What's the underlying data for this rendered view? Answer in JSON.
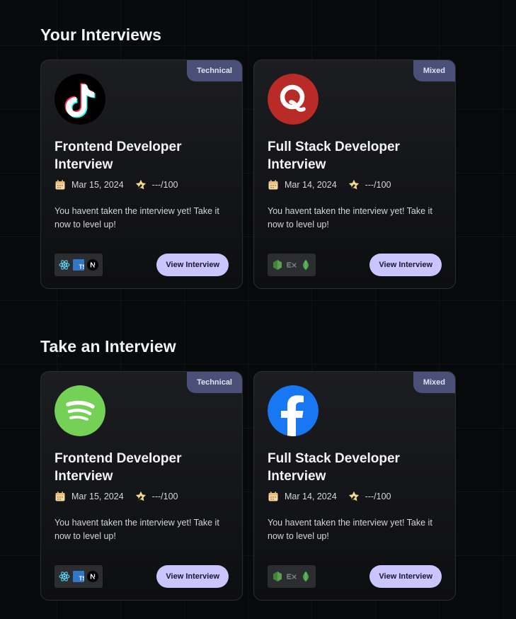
{
  "sections": [
    {
      "title": "Your Interviews",
      "cards": [
        {
          "badge": "Technical",
          "logo": "tiktok-logo",
          "title": "Frontend Developer Interview",
          "date": "Mar 15, 2024",
          "score": "---/100",
          "description": "You havent taken the interview yet! Take it now to level up!",
          "tech": [
            "react-icon",
            "typescript-icon",
            "nextjs-icon"
          ],
          "button": "View Interview"
        },
        {
          "badge": "Mixed",
          "logo": "quora-logo",
          "title": "Full Stack Developer Interview",
          "date": "Mar 14, 2024",
          "score": "---/100",
          "description": "You havent taken the interview yet! Take it now to level up!",
          "tech": [
            "nodejs-icon",
            "express-icon",
            "mongodb-icon"
          ],
          "button": "View Interview"
        }
      ]
    },
    {
      "title": "Take an Interview",
      "cards": [
        {
          "badge": "Technical",
          "logo": "spotify-logo",
          "title": "Frontend Developer Interview",
          "date": "Mar 15, 2024",
          "score": "---/100",
          "description": "You havent taken the interview yet! Take it now to level up!",
          "tech": [
            "react-icon",
            "typescript-icon",
            "nextjs-icon"
          ],
          "button": "View Interview"
        },
        {
          "badge": "Mixed",
          "logo": "facebook-logo",
          "title": "Full Stack Developer Interview",
          "date": "Mar 14, 2024",
          "score": "---/100",
          "description": "You havent taken the interview yet! Take it now to level up!",
          "tech": [
            "nodejs-icon",
            "express-icon",
            "mongodb-icon"
          ],
          "button": "View Interview"
        }
      ]
    }
  ],
  "colors": {
    "badge": "#4b5079",
    "button": "#cac5fe",
    "background": "#08090a"
  }
}
